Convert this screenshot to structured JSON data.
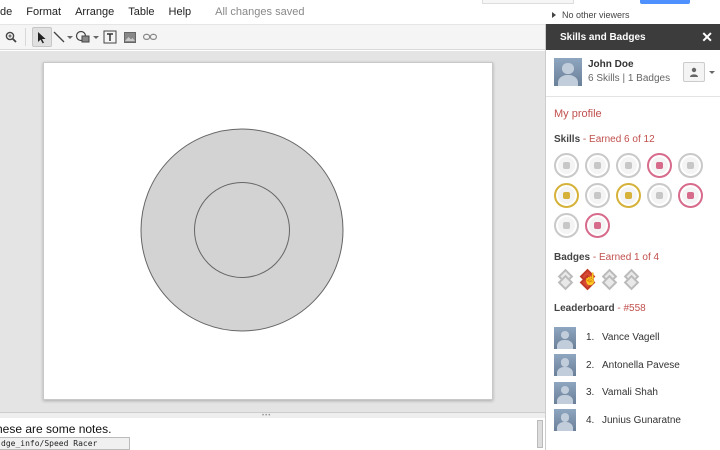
{
  "menubar": {
    "items": [
      "de",
      "Format",
      "Arrange",
      "Table",
      "Help"
    ],
    "saved_status": "All changes saved"
  },
  "viewers": {
    "text": "No other viewers"
  },
  "notes": {
    "text": "hese are some notes."
  },
  "status_url": "dge_info/Speed Racer",
  "toolbar": {
    "icons": [
      "zoom-icon",
      "select-pointer-icon",
      "line-icon",
      "shape-icon",
      "text-box-icon",
      "image-icon",
      "link-icon"
    ],
    "selected_tool": "select-pointer"
  },
  "slide": {
    "shape": "ring",
    "fill_color": "#d3d3d3",
    "stroke_color": "#666666"
  },
  "panel": {
    "title": "Skills and Badges",
    "user": {
      "name": "John Doe",
      "stats": "6 Skills | 1 Badges"
    },
    "my_profile": "My profile",
    "skills": {
      "title": "Skills",
      "sub": " - Earned 6 of 12"
    },
    "badges": {
      "title": "Badges",
      "sub": " - Earned 1 of 4"
    },
    "leaderboard": {
      "title": "Leaderboard",
      "sub": " - #558",
      "entries": [
        {
          "rank": "1.",
          "name": "Vance Vagell"
        },
        {
          "rank": "2.",
          "name": "Antonella Pavese"
        },
        {
          "rank": "3.",
          "name": "Vamali Shah"
        },
        {
          "rank": "4.",
          "name": "Junius Gunaratne"
        }
      ]
    },
    "skill_states": [
      "gray",
      "gray",
      "gray",
      "red",
      "gray",
      "gold",
      "gray",
      "gold",
      "gray",
      "red",
      "gray",
      "red"
    ],
    "badge_states": [
      "gray",
      "earned",
      "gray",
      "gray"
    ],
    "colors": {
      "accent": "#c0504d",
      "header_bg": "#3c3c3c",
      "earned_gold": "#d6b23a",
      "earned_red": "#d76b8c",
      "badge_red": "#d94a36"
    }
  }
}
